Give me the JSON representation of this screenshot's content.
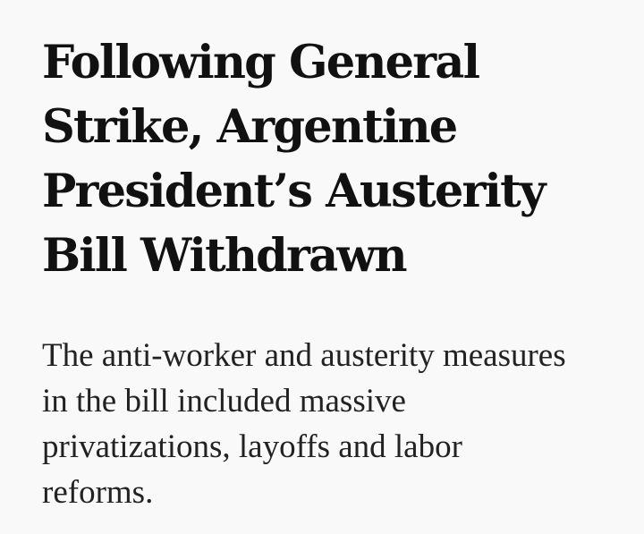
{
  "article": {
    "headline_lines": [
      "Following General",
      "Strike, Argentine",
      "President’s Austerity",
      "Bill Withdrawn"
    ],
    "dek_lines": [
      "The anti-worker and austerity measures",
      "in the bill included massive",
      "privatizations, layoffs and labor",
      "reforms."
    ]
  },
  "colors": {
    "background": "#f9f9f9",
    "headline": "#111111",
    "dek": "#222222"
  }
}
